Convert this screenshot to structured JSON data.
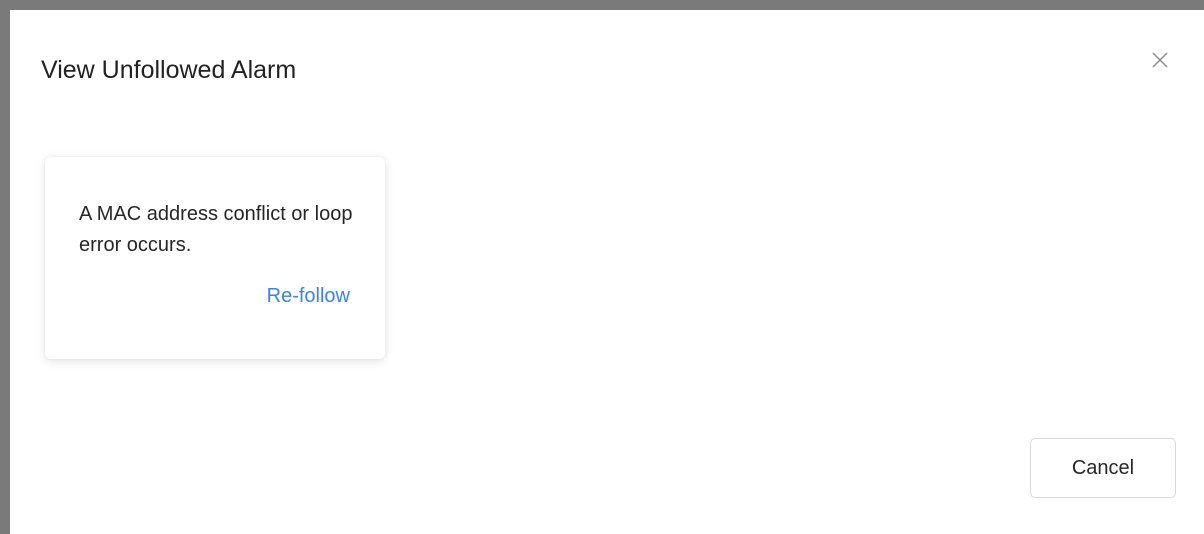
{
  "modal": {
    "title": "View Unfollowed Alarm",
    "close_icon": "close-icon"
  },
  "alarms": [
    {
      "message": "A MAC address conflict or loop error occurs.",
      "action_label": "Re-follow"
    }
  ],
  "footer": {
    "cancel_label": "Cancel"
  },
  "colors": {
    "link": "#3b82f0",
    "backdrop": "#7a7a7a"
  }
}
